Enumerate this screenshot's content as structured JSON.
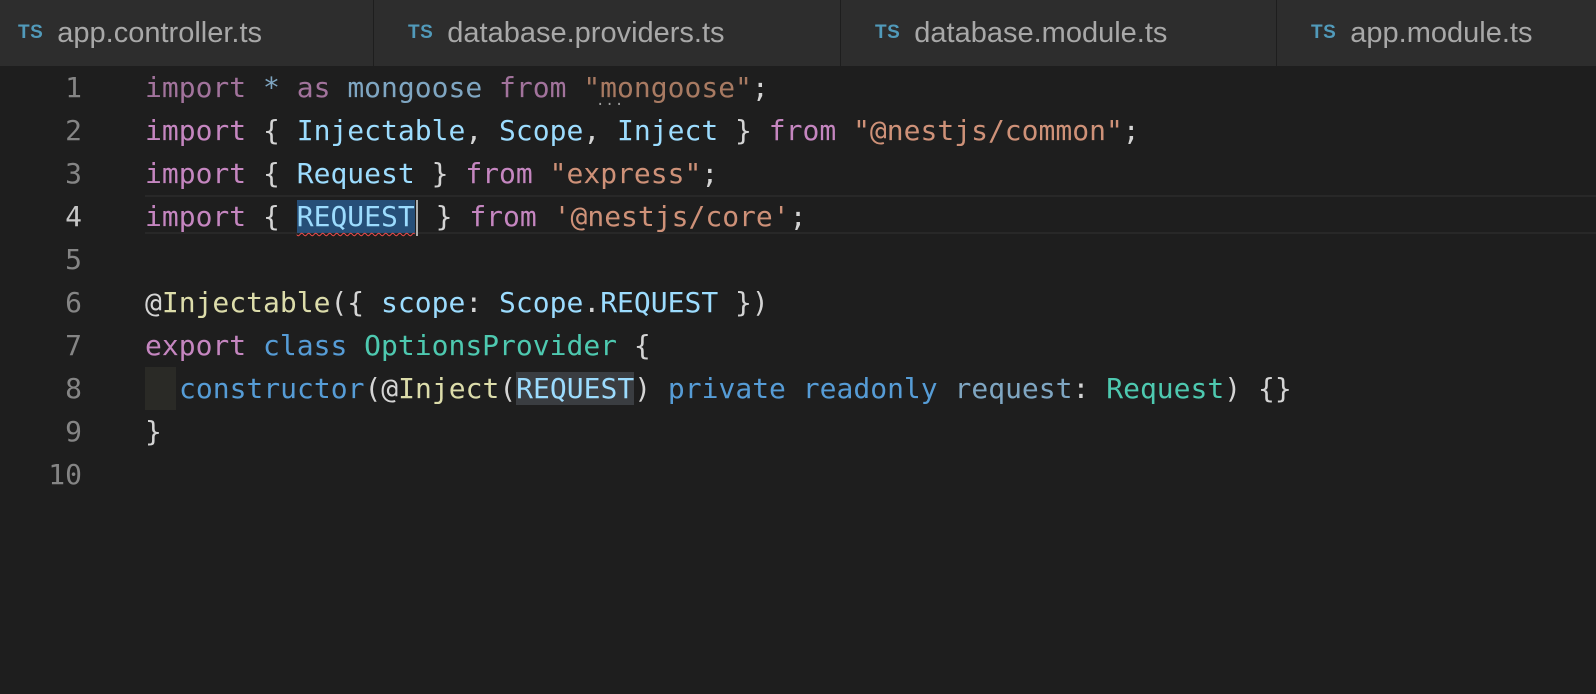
{
  "tabs": [
    {
      "icon": "TS",
      "label": "app.controller.ts"
    },
    {
      "icon": "TS",
      "label": "database.providers.ts"
    },
    {
      "icon": "TS",
      "label": "database.module.ts"
    },
    {
      "icon": "TS",
      "label": "app.module.ts"
    }
  ],
  "editor": {
    "active_line": "4",
    "ellipsis": "...",
    "lines": [
      {
        "number": "1",
        "tokens": [
          "import",
          " * ",
          "as",
          " ",
          "mongoose",
          " ",
          "from",
          " ",
          "\"mongoose\"",
          ";"
        ]
      },
      {
        "number": "2",
        "tokens": [
          "import",
          " { ",
          "Injectable",
          ", ",
          "Scope",
          ", ",
          "Inject",
          " } ",
          "from",
          " ",
          "\"@nestjs/common\"",
          ";"
        ]
      },
      {
        "number": "3",
        "tokens": [
          "import",
          " { ",
          "Request",
          " } ",
          "from",
          " ",
          "\"express\"",
          ";"
        ]
      },
      {
        "number": "4",
        "tokens": [
          "import",
          " { ",
          "REQUEST",
          " } ",
          "from",
          " ",
          "'@nestjs/core'",
          ";"
        ]
      },
      {
        "number": "5",
        "tokens": []
      },
      {
        "number": "6",
        "tokens": [
          "@",
          "Injectable",
          "({ ",
          "scope",
          ": ",
          "Scope",
          ".",
          "REQUEST",
          " })"
        ]
      },
      {
        "number": "7",
        "tokens": [
          "export",
          " ",
          "class",
          " ",
          "OptionsProvider",
          " {"
        ]
      },
      {
        "number": "8",
        "tokens": [
          "constructor",
          "(@",
          "Inject",
          "(",
          "REQUEST",
          ") ",
          "private",
          " ",
          "readonly",
          " ",
          "request",
          ": ",
          "Request",
          ") {}"
        ]
      },
      {
        "number": "9",
        "tokens": [
          "}"
        ]
      },
      {
        "number": "10",
        "tokens": []
      }
    ]
  },
  "colors": {
    "keyword": "#c586c0",
    "storage": "#569cd6",
    "function": "#dcdcaa",
    "string": "#ce9178",
    "variable": "#9cdcfe",
    "class": "#4ec9b0",
    "selection": "#264f78",
    "error_squiggle": "#f14c4c"
  }
}
